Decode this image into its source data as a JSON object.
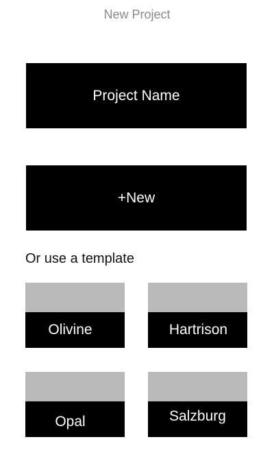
{
  "header": {
    "title": "New Project"
  },
  "actions": {
    "project_name_label": "Project Name",
    "new_label": "+New"
  },
  "templates": {
    "section_label": "Or use a template",
    "items": [
      {
        "label": "Olivine"
      },
      {
        "label": "Hartrison"
      },
      {
        "label": "Opal"
      },
      {
        "label": "Salzburg"
      }
    ]
  },
  "colors": {
    "button_bg": "#000000",
    "button_text": "#ffffff",
    "thumb_bg": "#b9b9b9",
    "title_text": "#8a8a8a"
  }
}
